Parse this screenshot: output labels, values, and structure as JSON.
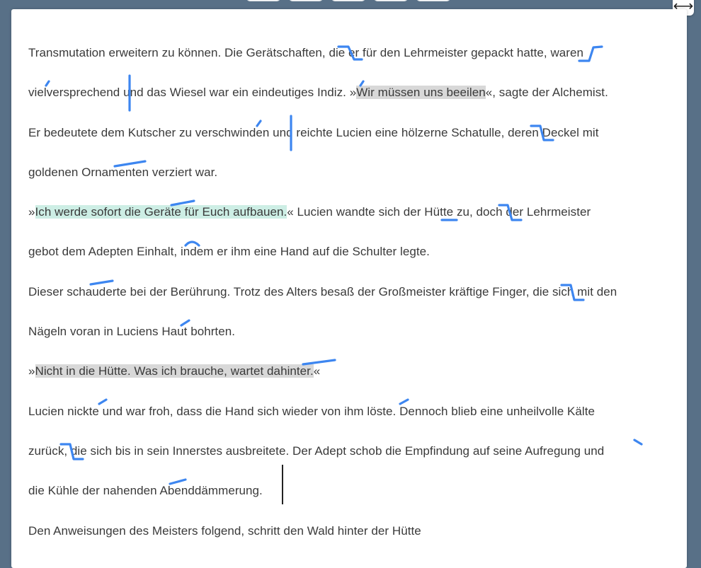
{
  "document": {
    "lines": [
      {
        "parts": [
          {
            "text": "Transmutation erweitern zu können. Die Gerätschaften, die er für den Lehrmeister gepackt hatte, waren"
          }
        ]
      },
      {
        "parts": [
          {
            "text": "vielversprechend und das Wiesel war ein eindeutiges Indiz. »"
          },
          {
            "text": "Wir müssen uns beeilen",
            "highlight": "gray"
          },
          {
            "text": "«, sagte der Alchemist."
          }
        ]
      },
      {
        "parts": [
          {
            "text": "Er bedeutete dem Kutscher zu verschwinden und reichte Lucien eine hölzerne Schatulle, deren Deckel mit"
          }
        ]
      },
      {
        "parts": [
          {
            "text": "goldenen Ornamenten verziert war."
          }
        ]
      },
      {
        "parts": [
          {
            "text": "»"
          },
          {
            "text": "Ich werde sofort die Geräte für Euch aufbauen.",
            "highlight": "green"
          },
          {
            "text": "« Lucien wandte sich der Hütte zu, doch der Lehrmeister"
          }
        ]
      },
      {
        "parts": [
          {
            "text": "gebot dem Adepten Einhalt, indem er ihm eine Hand auf die Schulter legte."
          }
        ]
      },
      {
        "parts": [
          {
            "text": "Dieser schauderte bei der Berührung. Trotz des Alters besaß der Großmeister kräftige Finger, die sich mit den"
          }
        ]
      },
      {
        "parts": [
          {
            "text": "Nägeln voran in Luciens Haut bohrten."
          }
        ]
      },
      {
        "parts": [
          {
            "text": "»"
          },
          {
            "text": "Nicht in die Hütte. Was ich brauche, wartet dahinter.",
            "highlight": "gray"
          },
          {
            "text": "«"
          }
        ]
      },
      {
        "parts": [
          {
            "text": "Lucien nickte und war froh, dass die Hand sich wieder von ihm löste. Dennoch blieb eine unheilvolle Kälte"
          }
        ]
      },
      {
        "parts": [
          {
            "text": "zurück, die sich bis in sein Innerstes ausbreitete. Der Adept schob die Empfindung auf seine Aufregung und"
          }
        ]
      },
      {
        "parts": [
          {
            "text": "die Kühle der nahenden Abenddämmerung."
          }
        ]
      },
      {
        "parts": [
          {
            "text": "Den Anweisungen des Meisters folgend, schritt den Wald hinter der Hütte"
          }
        ]
      }
    ]
  },
  "colors": {
    "background": "#587087",
    "paper": "#ffffff",
    "mark": "#3d86f0",
    "highlight_gray": "#d8d8d8",
    "highlight_green": "#cdeee5"
  },
  "toolbar": {
    "resize_icon": "resize-horizontal-icon"
  }
}
